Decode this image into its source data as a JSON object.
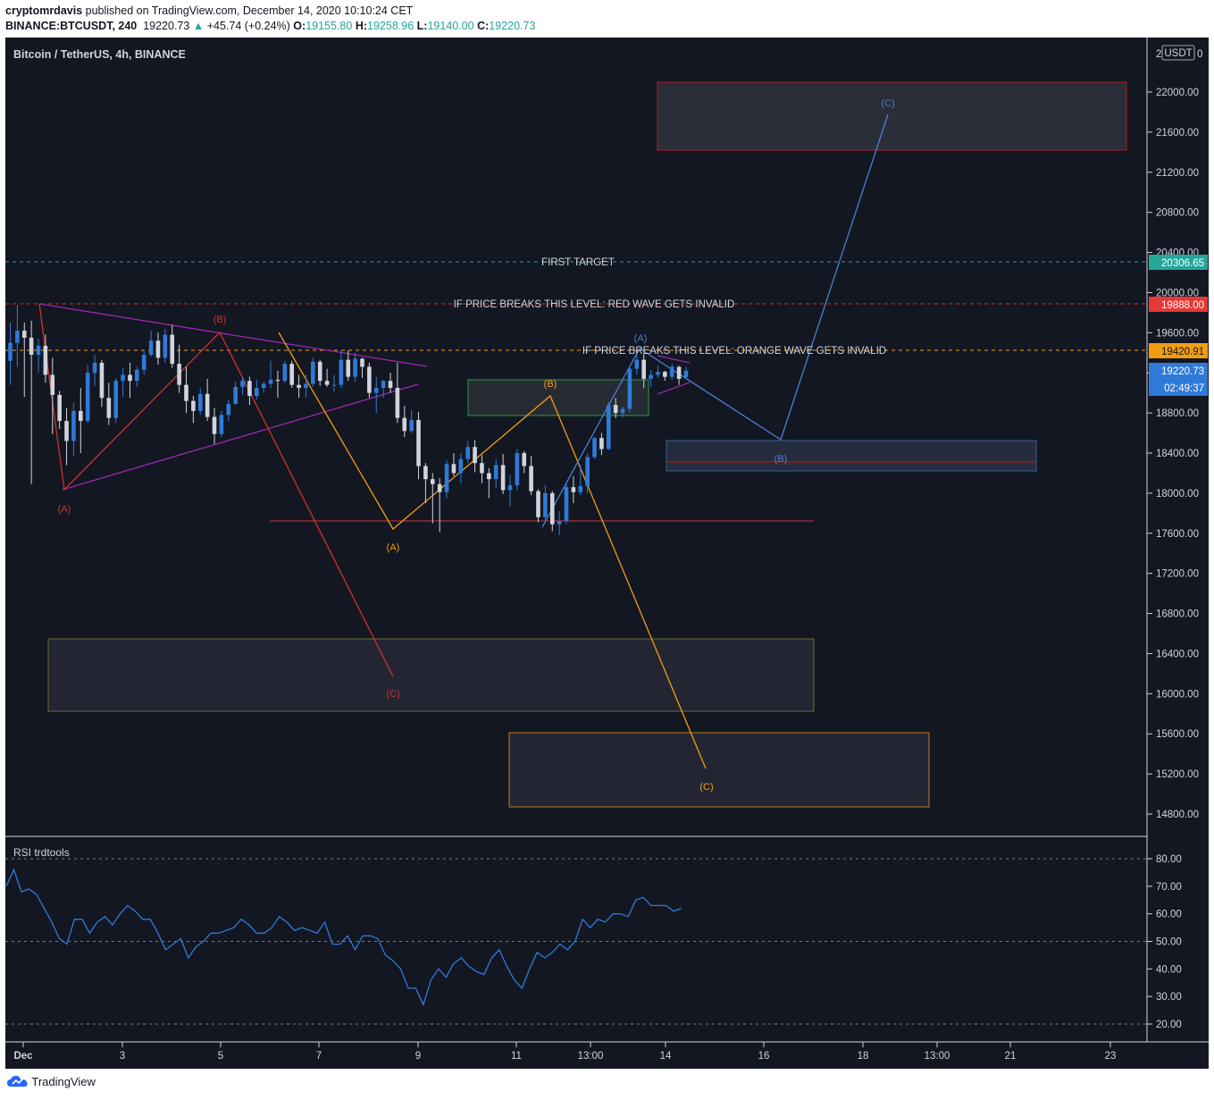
{
  "header": {
    "publisher": "cryptomrdavis",
    "published_text": "published on TradingView.com, December 14, 2020 10:10:24 CET",
    "symbol": "BINANCE:BTCUSDT, 240",
    "last": "19220.73",
    "change": "+45.74 (+0.24%)",
    "o_label": "O:",
    "o": "19155.80",
    "h_label": "H:",
    "h": "19258.96",
    "l_label": "L:",
    "l": "19140.00",
    "c_label": "C:",
    "c": "19220.73"
  },
  "chart": {
    "title": "Bitcoin / TetherUS, 4h, BINANCE",
    "currency": "USDT",
    "currency_prefix": "2",
    "currency_suffix": "0",
    "price_ticks": [
      "22000.00",
      "21600.00",
      "21200.00",
      "20800.00",
      "20400.00",
      "20000.00",
      "19600.00",
      "19200.00",
      "18800.00",
      "18400.00",
      "18000.00",
      "17600.00",
      "17200.00",
      "16800.00",
      "16400.00",
      "16000.00",
      "15600.00",
      "15200.00",
      "14800.00"
    ],
    "time_ticks": [
      "Dec",
      "3",
      "5",
      "7",
      "9",
      "11",
      "13:00",
      "14",
      "16",
      "18",
      "13:00",
      "21",
      "23"
    ],
    "badges": {
      "first_target": "20306.65",
      "red_invalid": "19888.00",
      "orange_invalid": "19420.91",
      "last_price": "19220.73",
      "countdown": "02:49:37"
    },
    "annotations": {
      "first_target": "FIRST TARGET",
      "red_invalid": "IF PRICE BREAKS THIS LEVEL: RED WAVE GETS INVALID",
      "orange_invalid": "IF PRICE BREAKS THIS LEVEL: ORANGE WAVE GETS INVALID"
    },
    "wave_labels": {
      "red_a": "(A)",
      "red_b": "(B)",
      "red_c": "(C)",
      "orange_a": "(A)",
      "orange_b": "(B)",
      "orange_c": "(C)",
      "blue_a": "(A)",
      "blue_b": "(B)",
      "blue_c": "(C)"
    },
    "colors": {
      "background": "#131722",
      "up": "#2f7ad8",
      "down": "#d1d4dc",
      "red_wave": "#d32f2f",
      "orange_wave": "#f39c12",
      "blue_wave": "#4a7fd0",
      "triangle": "#9c27b0",
      "first_target": "#26a69a",
      "grid": "#2a2e39"
    }
  },
  "rsi": {
    "title": "RSI trdtools",
    "ticks": [
      "80.00",
      "70.00",
      "60.00",
      "50.00",
      "40.00",
      "30.00",
      "20.00"
    ],
    "levels": [
      80,
      50,
      20
    ],
    "range": [
      14,
      84
    ]
  },
  "chart_data": {
    "type": "candlestick",
    "title": "Bitcoin / TetherUS, 4h, BINANCE",
    "x_unit": "4h candles from 2020-12-01 00:00",
    "ylim": [
      14500,
      22400
    ],
    "candles": [
      [
        19320,
        19700,
        19080,
        19500
      ],
      [
        19500,
        19880,
        19260,
        19620
      ],
      [
        19620,
        19700,
        18960,
        19550
      ],
      [
        19550,
        19720,
        18090,
        19380
      ],
      [
        19380,
        19540,
        19200,
        19470
      ],
      [
        19470,
        19580,
        19100,
        19180
      ],
      [
        19180,
        19350,
        18590,
        18980
      ],
      [
        18980,
        19020,
        18640,
        18720
      ],
      [
        18720,
        18850,
        18280,
        18520
      ],
      [
        18520,
        18900,
        18370,
        18820
      ],
      [
        18820,
        19050,
        18400,
        18720
      ],
      [
        18720,
        19280,
        18700,
        19200
      ],
      [
        19200,
        19380,
        19070,
        19300
      ],
      [
        19300,
        19330,
        18860,
        18950
      ],
      [
        18950,
        19100,
        18680,
        18750
      ],
      [
        18750,
        19150,
        18700,
        19120
      ],
      [
        19120,
        19250,
        18960,
        19180
      ],
      [
        19180,
        19300,
        18950,
        19120
      ],
      [
        19120,
        19260,
        19060,
        19230
      ],
      [
        19230,
        19430,
        19180,
        19380
      ],
      [
        19380,
        19620,
        19360,
        19520
      ],
      [
        19520,
        19600,
        19280,
        19350
      ],
      [
        19350,
        19640,
        19300,
        19580
      ],
      [
        19580,
        19680,
        19250,
        19290
      ],
      [
        19290,
        19480,
        19000,
        19080
      ],
      [
        19080,
        19260,
        18800,
        18920
      ],
      [
        18920,
        18970,
        18700,
        18820
      ],
      [
        18820,
        19050,
        18780,
        18990
      ],
      [
        18990,
        19140,
        18720,
        18760
      ],
      [
        18760,
        18850,
        18490,
        18590
      ],
      [
        18590,
        18820,
        18560,
        18780
      ],
      [
        18780,
        18930,
        18720,
        18890
      ],
      [
        18890,
        19110,
        18880,
        19060
      ],
      [
        19060,
        19160,
        18980,
        19120
      ],
      [
        19120,
        19160,
        18880,
        18970
      ],
      [
        18970,
        19130,
        18930,
        19050
      ],
      [
        19050,
        19110,
        19000,
        19090
      ],
      [
        19090,
        19320,
        19050,
        19130
      ],
      [
        19130,
        19220,
        18950,
        19120
      ],
      [
        19120,
        19320,
        19100,
        19290
      ],
      [
        19290,
        19320,
        19050,
        19080
      ],
      [
        19080,
        19180,
        18950,
        19050
      ],
      [
        19050,
        19180,
        18950,
        19090
      ],
      [
        19090,
        19350,
        19060,
        19310
      ],
      [
        19310,
        19330,
        19070,
        19120
      ],
      [
        19120,
        19240,
        19060,
        19080
      ],
      [
        19080,
        19180,
        19010,
        19080
      ],
      [
        19080,
        19420,
        19050,
        19330
      ],
      [
        19330,
        19420,
        19120,
        19160
      ],
      [
        19160,
        19400,
        19110,
        19340
      ],
      [
        19340,
        19350,
        19150,
        19260
      ],
      [
        19260,
        19300,
        18950,
        19000
      ],
      [
        19000,
        19160,
        18800,
        19050
      ],
      [
        19050,
        19130,
        18950,
        19120
      ],
      [
        19120,
        19200,
        19000,
        19050
      ],
      [
        19050,
        19300,
        18700,
        18750
      ],
      [
        18750,
        18870,
        18560,
        18620
      ],
      [
        18620,
        18830,
        18600,
        18730
      ],
      [
        18730,
        18810,
        18140,
        18270
      ],
      [
        18270,
        18300,
        17900,
        18140
      ],
      [
        18140,
        18200,
        17700,
        18090
      ],
      [
        18090,
        18150,
        17610,
        18010
      ],
      [
        18010,
        18330,
        17950,
        18290
      ],
      [
        18290,
        18400,
        18170,
        18200
      ],
      [
        18200,
        18400,
        18100,
        18340
      ],
      [
        18340,
        18520,
        18300,
        18460
      ],
      [
        18460,
        18530,
        18210,
        18300
      ],
      [
        18300,
        18380,
        18100,
        18200
      ],
      [
        18200,
        18250,
        17950,
        18140
      ],
      [
        18140,
        18340,
        18050,
        18280
      ],
      [
        18280,
        18390,
        17990,
        18030
      ],
      [
        18030,
        18180,
        17870,
        18080
      ],
      [
        18080,
        18440,
        18030,
        18400
      ],
      [
        18400,
        18420,
        18200,
        18270
      ],
      [
        18270,
        18370,
        17980,
        18020
      ],
      [
        18020,
        18040,
        17710,
        17760
      ],
      [
        17760,
        18080,
        17700,
        18000
      ],
      [
        18000,
        18020,
        17620,
        17690
      ],
      [
        17690,
        17820,
        17580,
        17720
      ],
      [
        17720,
        18100,
        17690,
        18060
      ],
      [
        18060,
        18170,
        17900,
        18010
      ],
      [
        18010,
        18280,
        17980,
        18070
      ],
      [
        18070,
        18400,
        18000,
        18360
      ],
      [
        18360,
        18560,
        18340,
        18550
      ],
      [
        18550,
        18600,
        18380,
        18440
      ],
      [
        18440,
        18910,
        18430,
        18880
      ],
      [
        18880,
        18950,
        18750,
        18800
      ],
      [
        18800,
        18860,
        18760,
        18840
      ],
      [
        18840,
        19250,
        18800,
        19240
      ],
      [
        19240,
        19420,
        19180,
        19330
      ],
      [
        19330,
        19390,
        19050,
        19140
      ],
      [
        19140,
        19230,
        19060,
        19180
      ],
      [
        19180,
        19270,
        19150,
        19210
      ],
      [
        19210,
        19220,
        19120,
        19160
      ],
      [
        19160,
        19290,
        19130,
        19260
      ],
      [
        19260,
        19270,
        19080,
        19140
      ],
      [
        19155.8,
        19258.96,
        19140,
        19220.73
      ]
    ],
    "horizontal_levels": [
      {
        "name": "FIRST TARGET",
        "value": 20306.65
      },
      {
        "name": "IF PRICE BREAKS THIS LEVEL: RED WAVE GETS INVALID",
        "value": 19888
      },
      {
        "name": "IF PRICE BREAKS THIS LEVEL: ORANGE WAVE GETS INVALID",
        "value": 19420.91
      }
    ],
    "rsi_values": [
      70,
      76,
      68,
      69,
      67,
      62,
      57,
      51,
      49,
      58,
      58,
      53,
      57,
      59,
      56,
      60,
      63,
      61,
      58,
      58,
      53,
      47,
      49,
      51,
      44,
      48,
      50,
      53,
      53,
      54,
      55,
      58,
      56,
      53,
      53,
      55,
      59,
      57,
      54,
      55,
      54,
      53,
      57,
      49,
      49,
      52,
      47,
      52,
      52,
      51,
      45,
      43,
      40,
      33,
      33,
      27,
      36,
      40,
      37,
      42,
      44,
      41,
      39,
      38,
      44,
      47,
      41,
      36,
      33,
      40,
      46,
      44,
      46,
      49,
      47,
      50,
      58,
      55,
      58,
      57,
      60,
      60,
      59,
      65,
      66,
      63,
      63,
      63,
      61,
      62
    ]
  }
}
